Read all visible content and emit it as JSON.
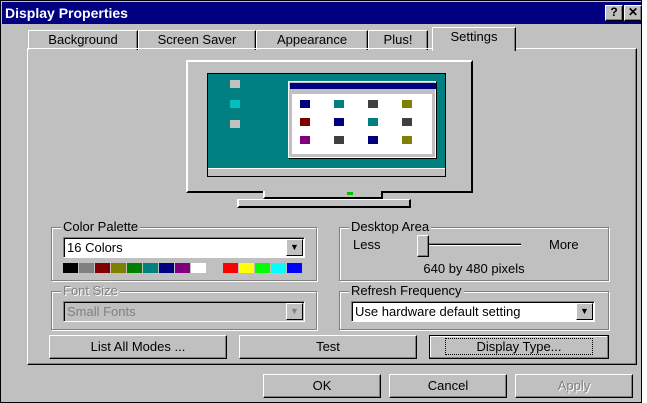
{
  "window": {
    "title": "Display Properties",
    "help_glyph": "?",
    "close_glyph": "✕"
  },
  "tabs": [
    {
      "label": "Background"
    },
    {
      "label": "Screen Saver"
    },
    {
      "label": "Appearance"
    },
    {
      "label": "Plus!"
    },
    {
      "label": "Settings"
    }
  ],
  "color_palette": {
    "label": "Color Palette",
    "value": "16 Colors",
    "swatches": [
      "#000000",
      "#808080",
      "#800000",
      "#808000",
      "#008000",
      "#008080",
      "#000080",
      "#800080",
      "#ffffff",
      "#c0c0c0",
      "#ff0000",
      "#ffff00",
      "#00ff00",
      "#00ffff",
      "#0000ff"
    ]
  },
  "desktop_area": {
    "label": "Desktop Area",
    "min_label": "Less",
    "max_label": "More",
    "resolution": "640 by 480 pixels"
  },
  "font_size": {
    "label": "Font Size",
    "value": "Small Fonts"
  },
  "refresh_frequency": {
    "label": "Refresh Frequency",
    "value": "Use hardware default setting"
  },
  "buttons": {
    "list_all_modes": "List All Modes ...",
    "test": "Test",
    "display_type": "Display Type...",
    "ok": "OK",
    "cancel": "Cancel",
    "apply": "Apply"
  }
}
